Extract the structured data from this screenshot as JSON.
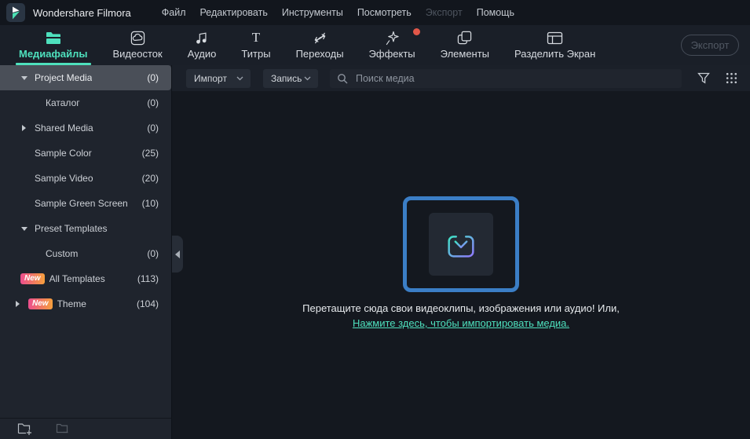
{
  "colors": {
    "accent": "#4ee0bd",
    "selection": "#4a4f58",
    "dropzone_border": "#3b7ec6",
    "notification_dot": "#e25749",
    "badge_start": "#ec4e8e",
    "badge_end": "#f6a03c",
    "icon_gradient_start": "#3fe3c6",
    "icon_gradient_end": "#9179ff"
  },
  "menubar": {
    "app_title": "Wondershare Filmora",
    "items": [
      {
        "name": "file",
        "label": "Файл",
        "enabled": true
      },
      {
        "name": "edit",
        "label": "Редактировать",
        "enabled": true
      },
      {
        "name": "tools",
        "label": "Инструменты",
        "enabled": true
      },
      {
        "name": "view",
        "label": "Посмотреть",
        "enabled": true
      },
      {
        "name": "export",
        "label": "Экспорт",
        "enabled": false
      },
      {
        "name": "help",
        "label": "Помощь",
        "enabled": true
      }
    ]
  },
  "tabbar": {
    "export_label": "Экспорт",
    "tabs": [
      {
        "name": "media-files",
        "label": "Медиафайлы",
        "icon": "folder-icon",
        "active": true,
        "notification_dot": false
      },
      {
        "name": "stock-media",
        "label": "Видеосток",
        "icon": "stock-media-icon",
        "active": false,
        "notification_dot": false
      },
      {
        "name": "audio",
        "label": "Аудио",
        "icon": "music-notes-icon",
        "active": false,
        "notification_dot": false
      },
      {
        "name": "titles",
        "label": "Титры",
        "icon": "titles-icon",
        "active": false,
        "notification_dot": false
      },
      {
        "name": "transitions",
        "label": "Переходы",
        "icon": "transitions-icon",
        "active": false,
        "notification_dot": false
      },
      {
        "name": "effects",
        "label": "Эффекты",
        "icon": "effects-icon",
        "active": false,
        "notification_dot": true
      },
      {
        "name": "elements",
        "label": "Элементы",
        "icon": "elements-icon",
        "active": false,
        "notification_dot": false
      },
      {
        "name": "split-screen",
        "label": "Разделить Экран",
        "icon": "split-screen-icon",
        "active": false,
        "notification_dot": false
      }
    ]
  },
  "toolbar": {
    "import_label": "Импорт",
    "record_label": "Запись",
    "search_placeholder": "Поиск медиа"
  },
  "sidebar": {
    "items": [
      {
        "name": "project-media",
        "label": "Project Media",
        "count": "(0)",
        "indent": 1,
        "expander": "down",
        "badge": "",
        "selected": true
      },
      {
        "name": "catalog",
        "label": "Каталог",
        "count": "(0)",
        "indent": 2,
        "expander": "",
        "badge": "",
        "selected": false
      },
      {
        "name": "shared-media",
        "label": "Shared Media",
        "count": "(0)",
        "indent": 1,
        "expander": "right",
        "badge": "",
        "selected": false
      },
      {
        "name": "sample-color",
        "label": "Sample Color",
        "count": "(25)",
        "indent": 1,
        "expander": "",
        "badge": "",
        "selected": false
      },
      {
        "name": "sample-video",
        "label": "Sample Video",
        "count": "(20)",
        "indent": 1,
        "expander": "",
        "badge": "",
        "selected": false
      },
      {
        "name": "sample-green-screen",
        "label": "Sample Green Screen",
        "count": "(10)",
        "indent": 1,
        "expander": "",
        "badge": "",
        "selected": false
      },
      {
        "name": "preset-templates",
        "label": "Preset Templates",
        "count": "",
        "indent": 1,
        "expander": "down",
        "badge": "",
        "selected": false
      },
      {
        "name": "custom",
        "label": "Custom",
        "count": "(0)",
        "indent": 2,
        "expander": "",
        "badge": "",
        "selected": false
      },
      {
        "name": "all-templates",
        "label": "All Templates",
        "count": "(113)",
        "indent": 1,
        "expander": "",
        "badge": "New",
        "selected": false
      },
      {
        "name": "theme",
        "label": "Theme",
        "count": "(104)",
        "indent": 0,
        "expander": "right",
        "badge": "New",
        "selected": false
      }
    ]
  },
  "dropzone": {
    "message": "Перетащите сюда свои видеоклипы, изображения или аудио! Или,",
    "link_label": "Нажмите здесь, чтобы импортировать медиа."
  }
}
